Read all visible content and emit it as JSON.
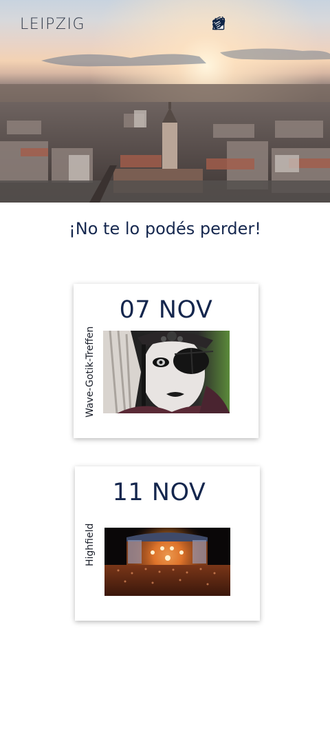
{
  "header": {
    "brand": "LEIPZIG",
    "nav": [
      {
        "icon": "home-icon"
      },
      {
        "icon": "tourist-guide-icon"
      },
      {
        "icon": "calendar-icon"
      },
      {
        "icon": "tickets-icon"
      }
    ]
  },
  "main": {
    "heading": "¡No te lo podés perder!",
    "events": [
      {
        "date": "07 NOV",
        "name": "Wave-Gotik-Treffen",
        "image": "gothic-portrait-photo"
      },
      {
        "date": "11 NOV",
        "name": "Highfield",
        "image": "concert-stage-photo"
      }
    ]
  },
  "colors": {
    "accent": "#16284f",
    "icon": "#0f2547",
    "card_background": "#ffffff"
  }
}
